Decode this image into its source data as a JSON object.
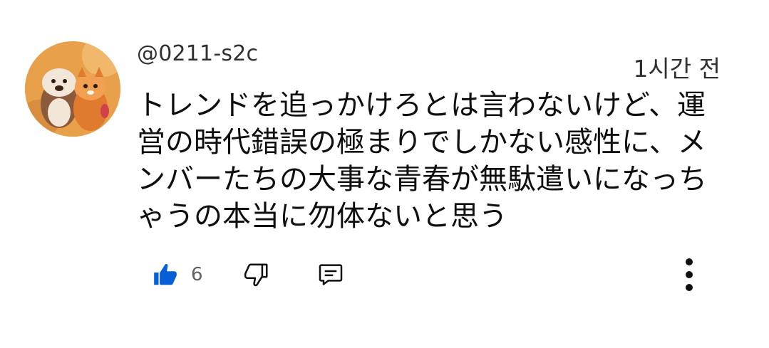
{
  "comment": {
    "author_handle": "@0211-s2c",
    "timestamp": "1시간 전",
    "text": "トレンドを追っかけろとは言わないけど、運営の時代錯誤の極まりでしかない感性に、メンバーたちの大事な青春が無駄遣いになっちゃうの本当に勿体ないと思う",
    "like_count": "6",
    "liked": true
  },
  "icons": {
    "like": "thumbs-up-icon",
    "dislike": "thumbs-down-icon",
    "reply": "comment-icon",
    "more": "more-vertical-icon"
  },
  "colors": {
    "like_active": "#065fd4",
    "icon_gray": "#606060"
  }
}
